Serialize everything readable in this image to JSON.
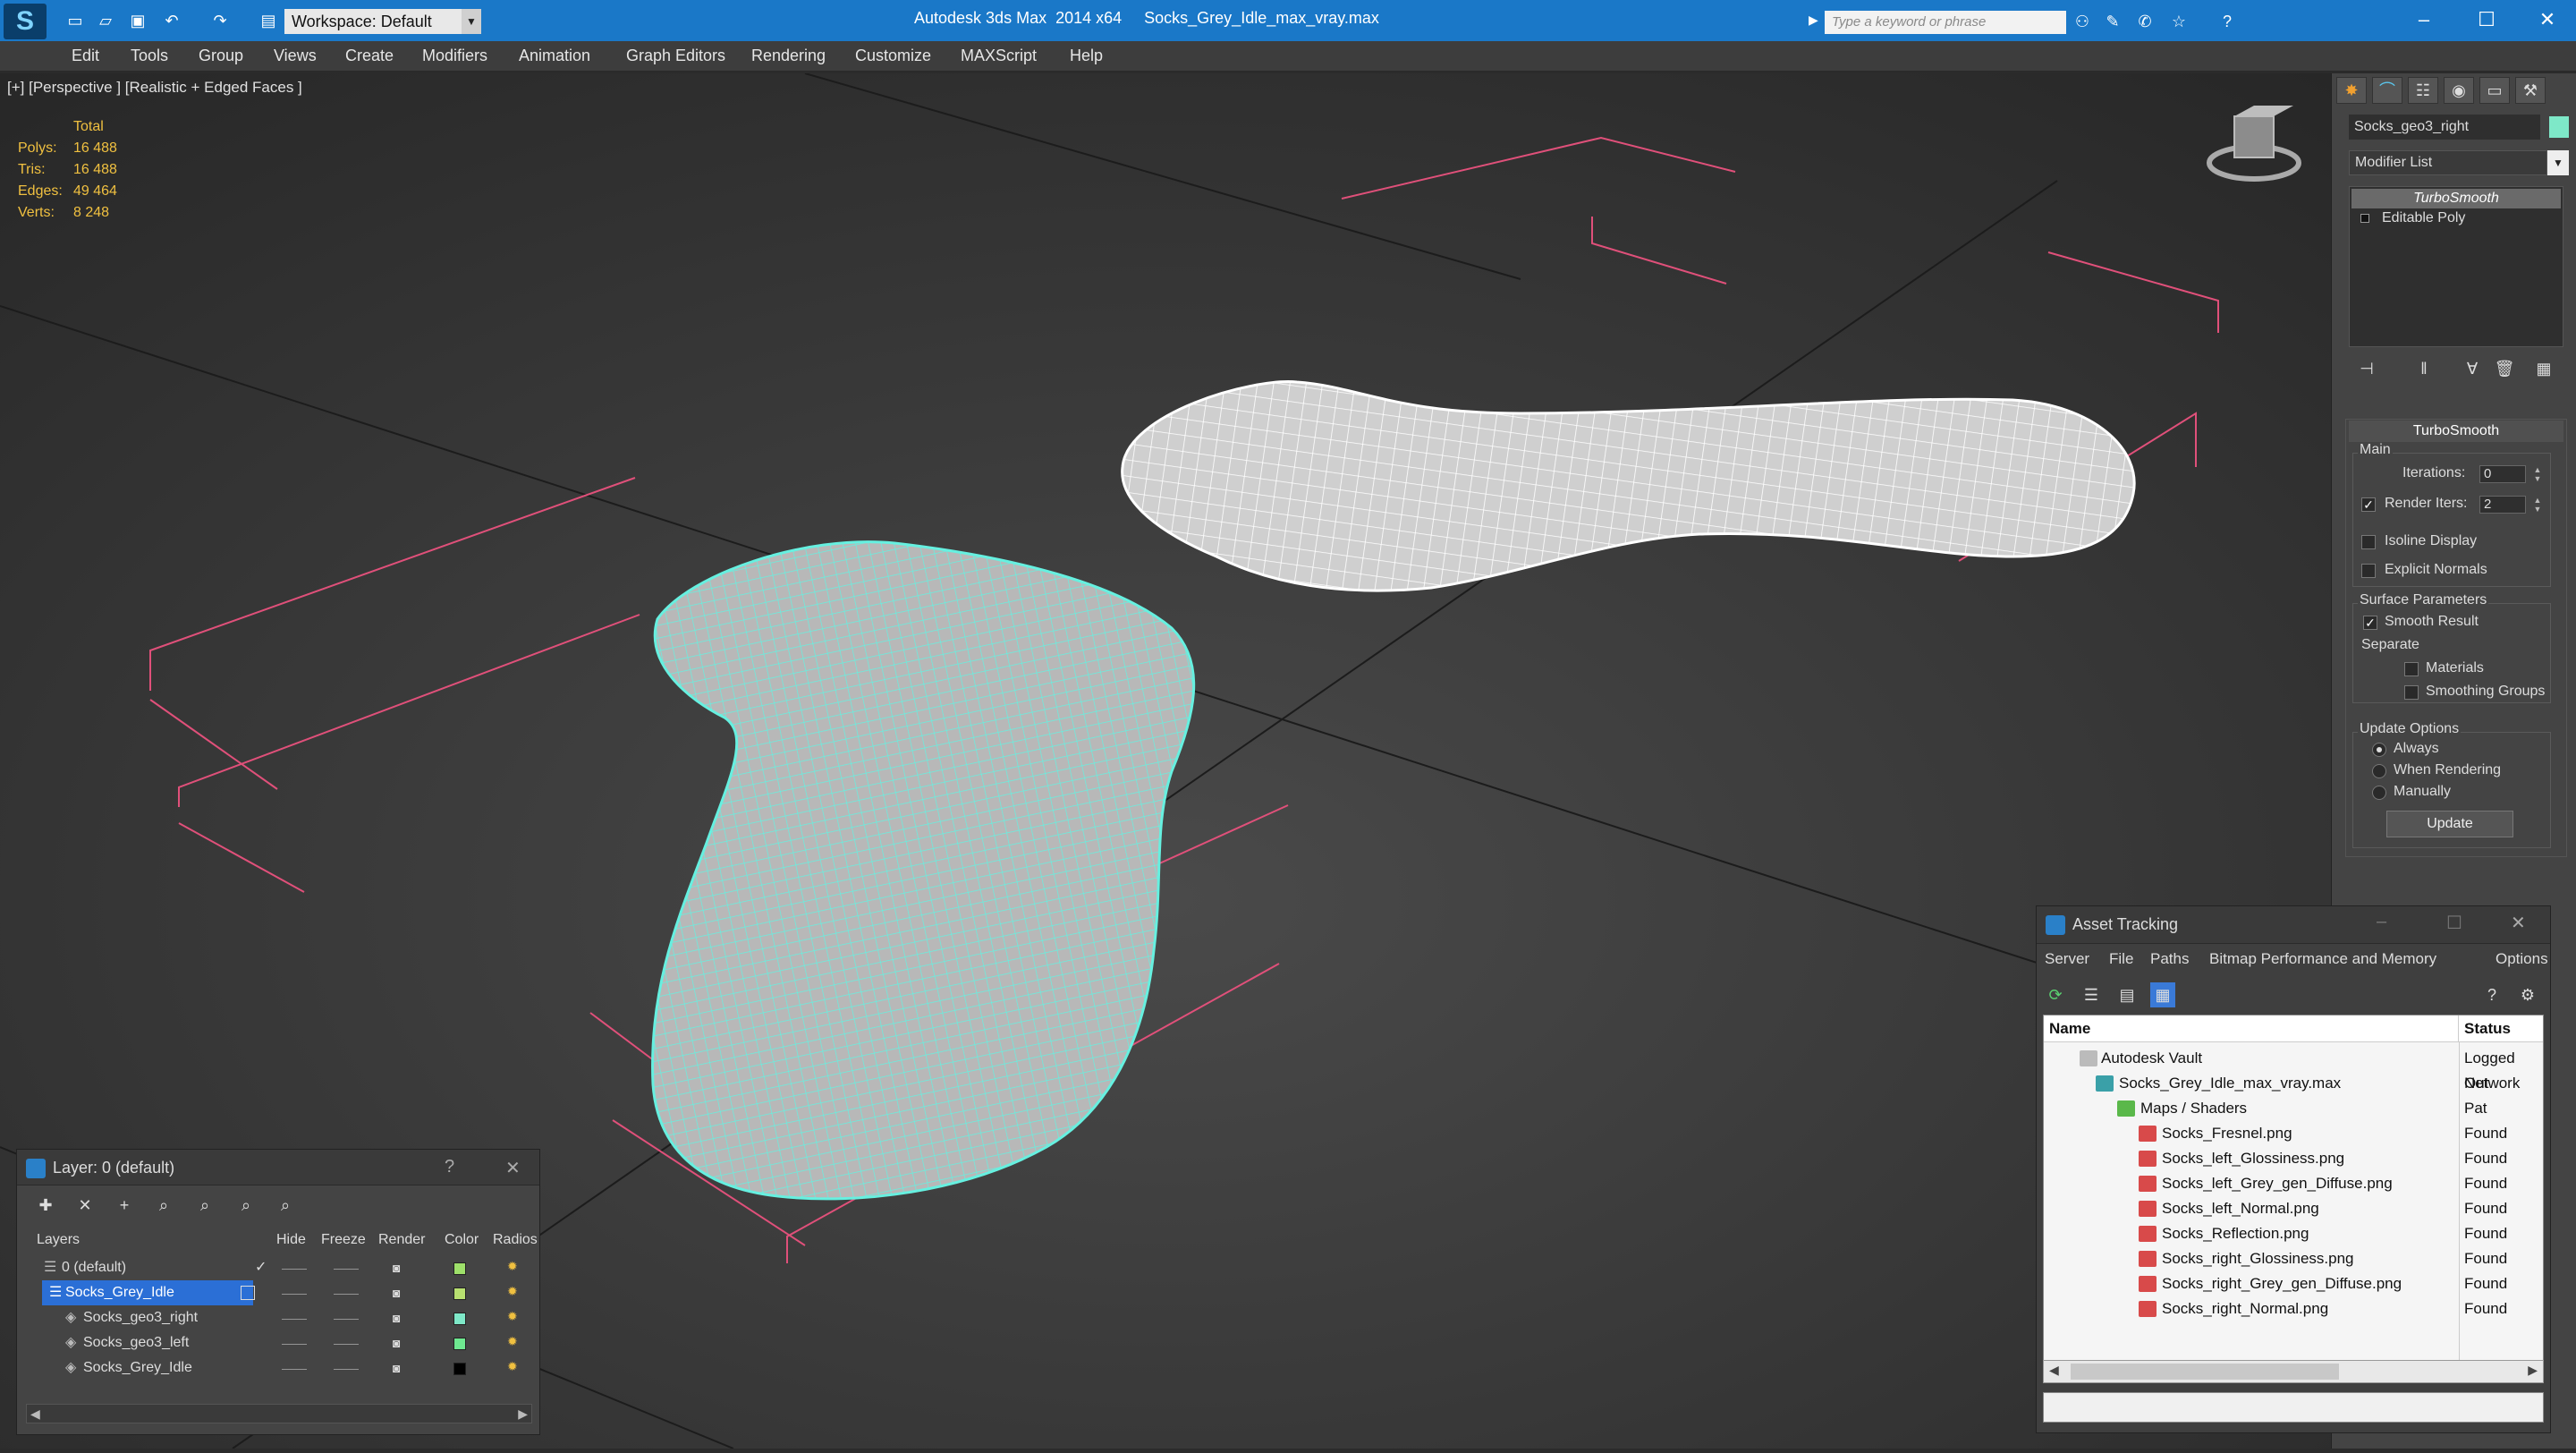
{
  "titlebar": {
    "workspace": "Workspace: Default",
    "app_title": "Autodesk 3ds Max  2014 x64     Socks_Grey_Idle_max_vray.max",
    "search_placeholder": "Type a keyword or phrase"
  },
  "menu": [
    "Edit",
    "Tools",
    "Group",
    "Views",
    "Create",
    "Modifiers",
    "Animation",
    "Graph Editors",
    "Rendering",
    "Customize",
    "MAXScript",
    "Help"
  ],
  "viewport": {
    "label": "[+] [Perspective ] [Realistic + Edged Faces ]",
    "stats": {
      "header": "Total",
      "rows": [
        {
          "k": "Polys:",
          "v": "16 488"
        },
        {
          "k": "Tris:",
          "v": "16 488"
        },
        {
          "k": "Edges:",
          "v": "49 464"
        },
        {
          "k": "Verts:",
          "v": "8 248"
        }
      ]
    }
  },
  "command_panel": {
    "object_name": "Socks_geo3_right",
    "object_color": "#7ee8c8",
    "modifier_list": "Modifier List",
    "stack": [
      "TurboSmooth",
      "Editable Poly"
    ],
    "rollout_title": "TurboSmooth",
    "main_label": "Main",
    "iterations_label": "Iterations:",
    "iterations_value": "0",
    "render_iters_label": "Render Iters:",
    "render_iters_value": "2",
    "isoline_label": "Isoline Display",
    "explicit_label": "Explicit Normals",
    "surface_label": "Surface Parameters",
    "smooth_result_label": "Smooth Result",
    "separate_label": "Separate",
    "materials_label": "Materials",
    "smoothing_label": "Smoothing Groups",
    "update_options_label": "Update Options",
    "always_label": "Always",
    "when_rendering_label": "When Rendering",
    "manually_label": "Manually",
    "update_button": "Update"
  },
  "layer_panel": {
    "title": "Layer: 0 (default)",
    "help": "?",
    "close": "✕",
    "headers": [
      "Layers",
      "Hide",
      "Freeze",
      "Render",
      "Color",
      "Radios"
    ],
    "rows": [
      {
        "name": "0 (default)",
        "color": "#9ee06a",
        "selected": false
      },
      {
        "name": "Socks_Grey_Idle",
        "color": "#b8e070",
        "selected": true
      },
      {
        "name": "Socks_geo3_right",
        "color": "#7ee8c8",
        "selected": false
      },
      {
        "name": "Socks_geo3_left",
        "color": "#6ee890",
        "selected": false
      },
      {
        "name": "Socks_Grey_Idle",
        "color": "#000000",
        "selected": false
      }
    ]
  },
  "asset_panel": {
    "title": "Asset Tracking",
    "menu": [
      "Server",
      "File",
      "Paths",
      "Bitmap Performance and Memory",
      "Options"
    ],
    "col_name": "Name",
    "col_status": "Status",
    "rows": [
      {
        "name": "Autodesk Vault",
        "status": "Logged Out",
        "indent": 1,
        "icon": "vault-icon"
      },
      {
        "name": "Socks_Grey_Idle_max_vray.max",
        "status": "Network Pat",
        "indent": 2,
        "icon": "max-file-icon"
      },
      {
        "name": "Maps / Shaders",
        "status": "",
        "indent": 3,
        "icon": "maps-icon"
      },
      {
        "name": "Socks_Fresnel.png",
        "status": "Found",
        "indent": 4,
        "icon": "png-icon"
      },
      {
        "name": "Socks_left_Glossiness.png",
        "status": "Found",
        "indent": 4,
        "icon": "png-icon"
      },
      {
        "name": "Socks_left_Grey_gen_Diffuse.png",
        "status": "Found",
        "indent": 4,
        "icon": "png-icon"
      },
      {
        "name": "Socks_left_Normal.png",
        "status": "Found",
        "indent": 4,
        "icon": "png-icon"
      },
      {
        "name": "Socks_Reflection.png",
        "status": "Found",
        "indent": 4,
        "icon": "png-icon"
      },
      {
        "name": "Socks_right_Glossiness.png",
        "status": "Found",
        "indent": 4,
        "icon": "png-icon"
      },
      {
        "name": "Socks_right_Grey_gen_Diffuse.png",
        "status": "Found",
        "indent": 4,
        "icon": "png-icon"
      },
      {
        "name": "Socks_right_Normal.png",
        "status": "Found",
        "indent": 4,
        "icon": "png-icon"
      }
    ]
  }
}
